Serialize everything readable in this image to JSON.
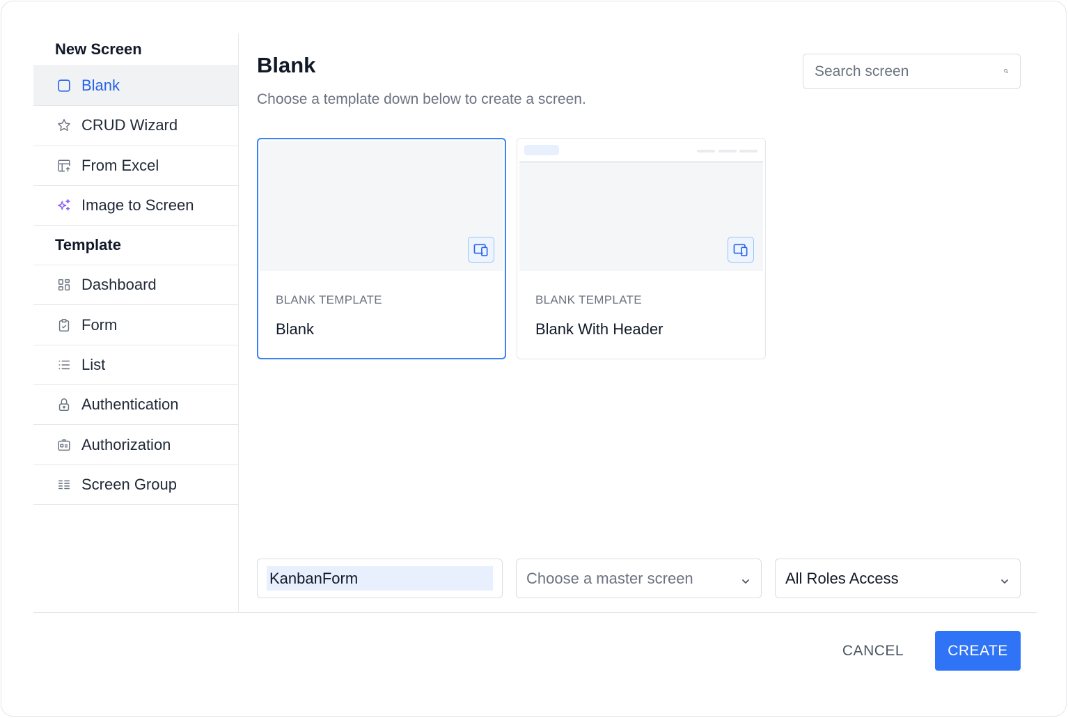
{
  "sidebar": {
    "new_screen_title": "New Screen",
    "new_items": [
      {
        "label": "Blank",
        "icon": "square-icon",
        "active": true
      },
      {
        "label": "CRUD Wizard",
        "icon": "star-icon"
      },
      {
        "label": "From Excel",
        "icon": "table-upload-icon"
      },
      {
        "label": "Image to Screen",
        "icon": "sparkles-icon",
        "accent": "#8b5cf6"
      }
    ],
    "template_title": "Template",
    "template_items": [
      {
        "label": "Dashboard",
        "icon": "dashboard-icon"
      },
      {
        "label": "Form",
        "icon": "clipboard-check-icon"
      },
      {
        "label": "List",
        "icon": "list-icon"
      },
      {
        "label": "Authentication",
        "icon": "lock-icon"
      },
      {
        "label": "Authorization",
        "icon": "id-card-icon"
      },
      {
        "label": "Screen Group",
        "icon": "columns-list-icon"
      }
    ]
  },
  "main": {
    "title": "Blank",
    "subtitle": "Choose a template down below to create a screen.",
    "search_placeholder": "Search screen",
    "cards": [
      {
        "kicker": "BLANK TEMPLATE",
        "name": "Blank",
        "selected": true
      },
      {
        "kicker": "BLANK TEMPLATE",
        "name": "Blank With Header",
        "selected": false
      }
    ]
  },
  "form": {
    "screen_name_value": "KanbanForm",
    "master_screen_placeholder": "Choose a master screen",
    "roles_value": "All Roles Access"
  },
  "actions": {
    "cancel_label": "CANCEL",
    "create_label": "CREATE"
  },
  "colors": {
    "accent": "#2f73f7",
    "active_bg": "#f1f2f4",
    "selected_border": "#3b82f6"
  }
}
